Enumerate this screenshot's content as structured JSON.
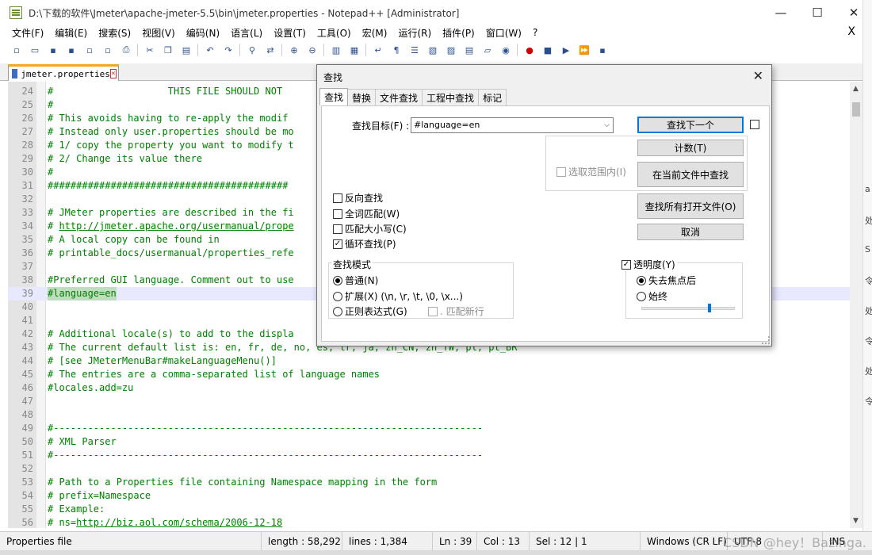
{
  "window": {
    "title": "D:\\下载的软件\\Jmeter\\apache-jmeter-5.5\\bin\\jmeter.properties - Notepad++ [Administrator]",
    "min": "—",
    "max": "☐",
    "close": "✕"
  },
  "menu": [
    "文件(F)",
    "编辑(E)",
    "搜索(S)",
    "视图(V)",
    "编码(N)",
    "语言(L)",
    "设置(T)",
    "工具(O)",
    "宏(M)",
    "运行(R)",
    "插件(P)",
    "窗口(W)",
    "?"
  ],
  "menu_close": "X",
  "tab": {
    "label": "jmeter.properties"
  },
  "lines": [
    {
      "n": "24",
      "t": "#                    THIS FILE SHOULD NOT"
    },
    {
      "n": "25",
      "t": "#"
    },
    {
      "n": "26",
      "t": "# This avoids having to re-apply the modif"
    },
    {
      "n": "27",
      "t": "# Instead only user.properties should be mo"
    },
    {
      "n": "28",
      "t": "# 1/ copy the property you want to modify t"
    },
    {
      "n": "29",
      "t": "# 2/ Change its value there"
    },
    {
      "n": "30",
      "t": "#"
    },
    {
      "n": "31",
      "t": "##########################################"
    },
    {
      "n": "32",
      "t": ""
    },
    {
      "n": "33",
      "t": "# JMeter properties are described in the fi"
    },
    {
      "n": "34",
      "t": "# http://jmeter.apache.org/usermanual/prope"
    },
    {
      "n": "35",
      "t": "# A local copy can be found in"
    },
    {
      "n": "36",
      "t": "# printable_docs/usermanual/properties_refe"
    },
    {
      "n": "37",
      "t": ""
    },
    {
      "n": "38",
      "t": "#Preferred GUI language. Comment out to use"
    },
    {
      "n": "39",
      "t": "#language=en"
    },
    {
      "n": "40",
      "t": ""
    },
    {
      "n": "41",
      "t": ""
    },
    {
      "n": "42",
      "t": "# Additional locale(s) to add to the displa"
    },
    {
      "n": "43",
      "t": "# The current default list is: en, fr, de, no, es, tr, ja, zh_CN, zh_TW, pl, pt_BR"
    },
    {
      "n": "44",
      "t": "# [see JMeterMenuBar#makeLanguageMenu()]"
    },
    {
      "n": "45",
      "t": "# The entries are a comma-separated list of language names"
    },
    {
      "n": "46",
      "t": "#locales.add=zu"
    },
    {
      "n": "47",
      "t": ""
    },
    {
      "n": "48",
      "t": ""
    },
    {
      "n": "49",
      "t": "#---------------------------------------------------------------------------"
    },
    {
      "n": "50",
      "t": "# XML Parser"
    },
    {
      "n": "51",
      "t": "#---------------------------------------------------------------------------"
    },
    {
      "n": "52",
      "t": ""
    },
    {
      "n": "53",
      "t": "# Path to a Properties file containing Namespace mapping in the form"
    },
    {
      "n": "54",
      "t": "# prefix=Namespace"
    },
    {
      "n": "55",
      "t": "# Example:"
    },
    {
      "n": "56",
      "t": "# ns=http://biz.aol.com/schema/2006-12-18"
    }
  ],
  "status": {
    "type": "Properties file",
    "length": "length : 58,292",
    "lines": "lines : 1,384",
    "ln": "Ln : 39",
    "col": "Col : 13",
    "sel": "Sel : 12 | 1",
    "eol": "Windows (CR LF)",
    "enc": "UTF-8",
    "ins": "INS"
  },
  "watermark": "CSDN @hey！Bazinga.",
  "backdrop": [
    "a",
    "处",
    "S",
    "令",
    "处",
    "令",
    "处",
    "令"
  ],
  "find": {
    "title": "查找",
    "close": "✕",
    "tabs": [
      "查找",
      "替换",
      "文件查找",
      "工程中查找",
      "标记"
    ],
    "target_label": "查找目标(F) :",
    "target_value": "#language=en",
    "btn_find_next": "查找下一个",
    "btn_count": "计数(T)",
    "btn_find_in_current": "在当前文件中查找",
    "btn_find_in_all": "查找所有打开文件(O)",
    "btn_cancel": "取消",
    "in_selection": "选取范围内(I)",
    "opt_backward": "反向查找",
    "opt_whole_word": "全词匹配(W)",
    "opt_match_case": "匹配大小写(C)",
    "opt_wrap": "循环查找(P)",
    "mode_title": "查找模式",
    "mode_normal": "普通(N)",
    "mode_extended": "扩展(X) (\\n, \\r, \\t, \\0, \\x...)",
    "mode_regex": "正则表达式(G)",
    "mode_newline": ". 匹配新行",
    "transparency": "透明度(Y)",
    "trans_on_lose_focus": "失去焦点后",
    "trans_always": "始终",
    "transparency_level": 0.72,
    "opt_wrap_checked": true,
    "transparency_checked": true
  }
}
